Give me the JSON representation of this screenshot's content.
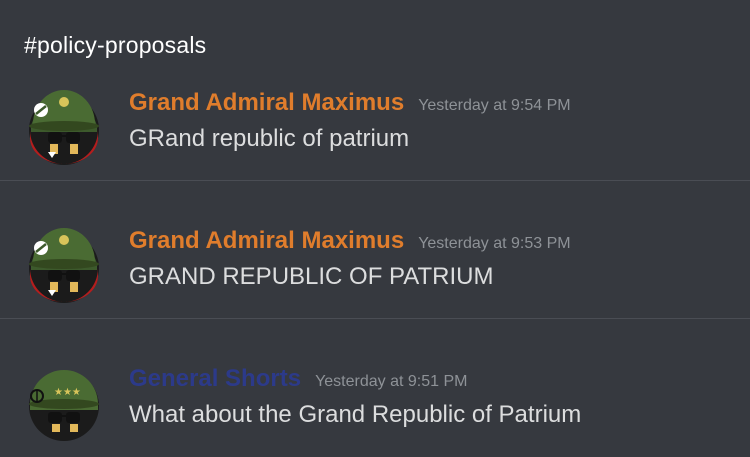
{
  "channel": {
    "name": "#policy-proposals"
  },
  "messages": [
    {
      "author": "Grand Admiral Maximus",
      "author_color": "#e07d2c",
      "timestamp": "Yesterday at 9:54 PM",
      "text": "GRand republic of patrium",
      "avatar": "countryball-soldier-avatar"
    },
    {
      "author": "Grand Admiral Maximus",
      "author_color": "#e07d2c",
      "timestamp": "Yesterday at 9:53 PM",
      "text": "GRAND REPUBLIC OF PATRIUM",
      "avatar": "countryball-soldier-avatar"
    },
    {
      "author": "General Shorts",
      "author_color": "#2c3a8a",
      "timestamp": "Yesterday at 9:51 PM",
      "text": "What about the Grand Republic of Patrium",
      "avatar": "countryball-general-avatar"
    }
  ],
  "colors": {
    "background": "#36393f",
    "divider": "#4a4d54",
    "text": "#dcddde",
    "timestamp": "#8e9297"
  }
}
